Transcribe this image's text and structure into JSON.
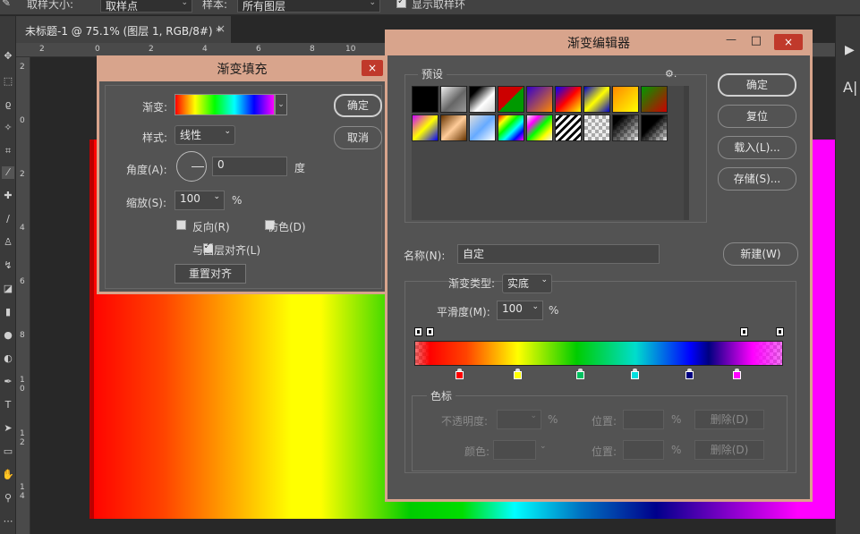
{
  "options_bar": {
    "sample_size_label": "取样大小:",
    "sample_size_value": "取样点",
    "sample_label": "样本:",
    "sample_value": "所有图层",
    "show_ring_label": "显示取样环"
  },
  "doc_tab": {
    "title": "未标题-1 @ 75.1% (图层 1, RGB/8#) *",
    "close": "×"
  },
  "ruler": {
    "top": [
      "2",
      "0",
      "2",
      "4",
      "6",
      "8",
      "10"
    ],
    "left": [
      "2",
      "0",
      "2",
      "4",
      "6",
      "8",
      "1",
      "0",
      "1",
      "2",
      "1",
      "4"
    ]
  },
  "right_panel": {
    "play": "▶",
    "label": "A|"
  },
  "gradient_fill": {
    "title": "渐变填充",
    "close": "×",
    "gradient_label": "渐变:",
    "style_label": "样式:",
    "style_value": "线性",
    "angle_label": "角度(A):",
    "angle_value": "0",
    "angle_unit": "度",
    "scale_label": "缩放(S):",
    "scale_value": "100",
    "scale_unit": "%",
    "reverse_label": "反向(R)",
    "dither_label": "仿色(D)",
    "align_label": "与图层对齐(L)",
    "align_checked": true,
    "reset_align_label": "重置对齐",
    "ok_label": "确定",
    "cancel_label": "取消"
  },
  "gradient_editor": {
    "title": "渐变编辑器",
    "minimize": "—",
    "maximize": "□",
    "close": "×",
    "presets_label": "预设",
    "gear": "⚙.",
    "ok_label": "确定",
    "reset_label": "复位",
    "load_label": "载入(L)...",
    "save_label": "存储(S)...",
    "name_label": "名称(N):",
    "name_value": "自定",
    "new_label": "新建(W)",
    "type_label": "渐变类型:",
    "type_value": "实底",
    "smooth_label": "平滑度(M):",
    "smooth_value": "100",
    "smooth_unit": "%",
    "stops_group_label": "色标",
    "opacity_label": "不透明度:",
    "opacity_unit": "%",
    "position_label": "位置:",
    "position_unit": "%",
    "delete_label": "删除(D)",
    "color_label": "颜色:",
    "position2_label": "位置:",
    "position2_unit": "%",
    "delete2_label": "删除(D)",
    "color_stop_colors": [
      "#ff0000",
      "#ffff00",
      "#00c060",
      "#00e0e0",
      "#000080",
      "#ff00ff"
    ]
  }
}
